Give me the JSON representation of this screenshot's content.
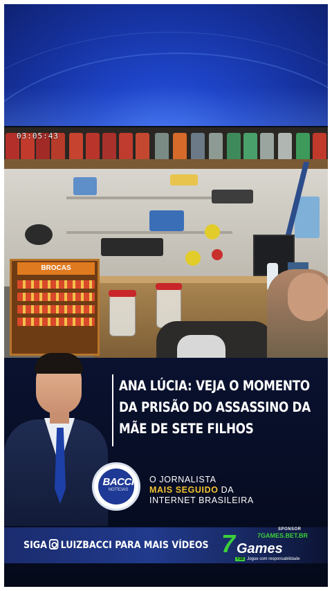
{
  "video": {
    "cctv_timestamp": "03:05:43"
  },
  "headline": {
    "line1": "ANA LÚCIA: VEJA O MOMENTO",
    "line2": "DA PRISÃO DO ASSASSINO DA",
    "line3": "MÃE DE SETE FILHOS"
  },
  "brand": {
    "logo_main": "BACCI",
    "logo_sub": "NOTÍCIAS"
  },
  "tagline": {
    "line1": "O JORNALISTA",
    "line2_highlight": "MAIS SEGUIDO",
    "line2_rest": " DA",
    "line3": "INTERNET BRASILEIRA"
  },
  "footer": {
    "follow_prefix": "SIGA",
    "follow_handle": "LUIZBACCI PARA MAIS VÍDEOS",
    "sponsor_label": "SPONSOR",
    "sponsor_site": "7GAMES.BET.BR",
    "sponsor_seven": "7",
    "sponsor_name": "Games",
    "sponsor_age": "+18",
    "sponsor_note": "Jogue com responsabilidade"
  },
  "display": {
    "sign": "BROCAS"
  },
  "colors": {
    "accent_yellow": "#f2c230",
    "brand_blue": "#1f3a96",
    "sponsor_green": "#3ccf3a",
    "background": "#060b1c"
  }
}
